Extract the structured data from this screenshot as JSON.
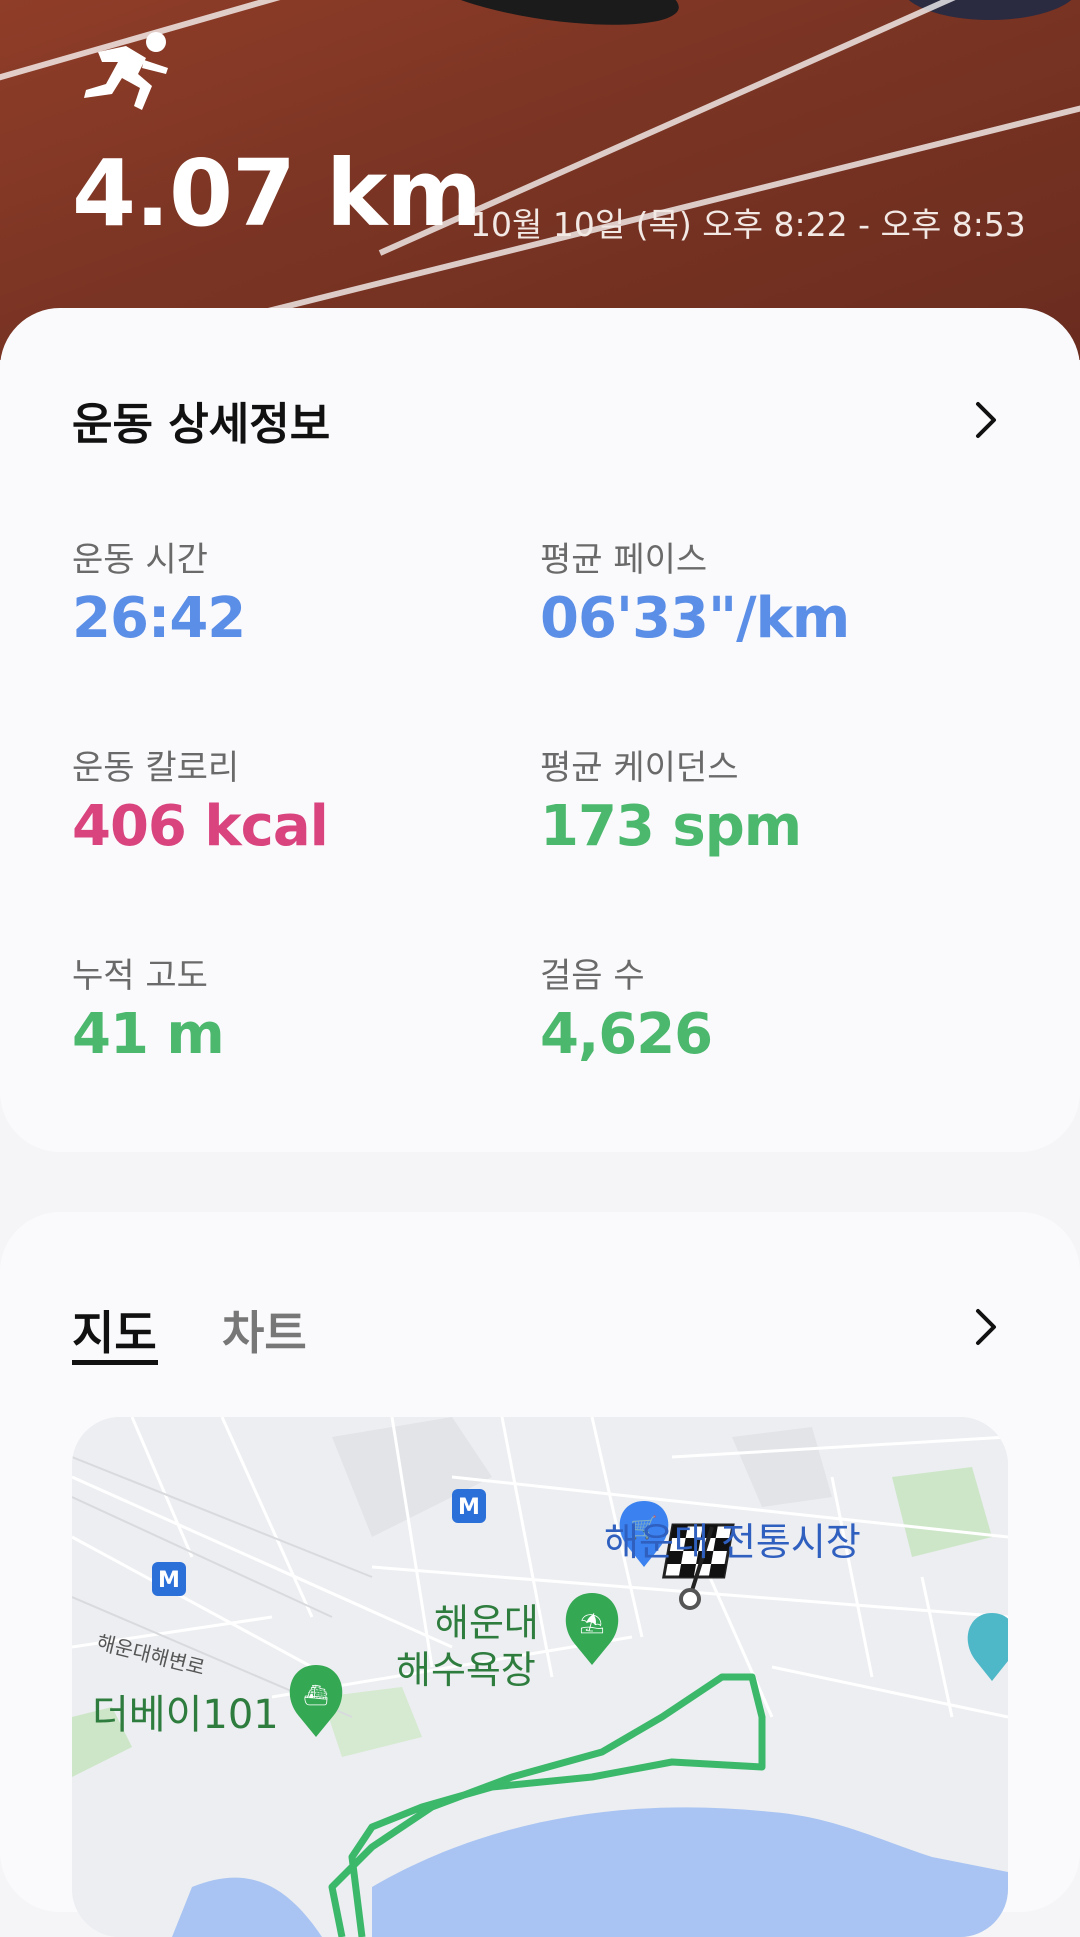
{
  "header": {
    "distance": "4.07 km",
    "datetime": "10월 10일 (목) 오후 8:22 - 오후 8:53",
    "icon": "runner-icon"
  },
  "details": {
    "title": "운동 상세정보",
    "stats": [
      {
        "label": "운동 시간",
        "value": "26:42",
        "color": "#5b8ee6"
      },
      {
        "label": "평균 페이스",
        "value": "06'33\"/km",
        "color": "#5b8ee6"
      },
      {
        "label": "운동 칼로리",
        "value": "406 kcal",
        "color": "#d9437e"
      },
      {
        "label": "평균 케이던스",
        "value": "173 spm",
        "color": "#4cb86e"
      },
      {
        "label": "누적 고도",
        "value": "41 m",
        "color": "#4cb86e"
      },
      {
        "label": "걸음 수",
        "value": "4,626",
        "color": "#4cb86e"
      }
    ]
  },
  "tabs": {
    "map_label": "지도",
    "chart_label": "차트",
    "active": "지도"
  },
  "map": {
    "labels": {
      "market": "해운대 전통시장",
      "beach_line1": "해운대",
      "beach_line2": "해수욕장",
      "road": "해운대해변로",
      "thebay": "더베이101"
    },
    "metro_badge": "M",
    "route_color": "#3cb86a"
  }
}
